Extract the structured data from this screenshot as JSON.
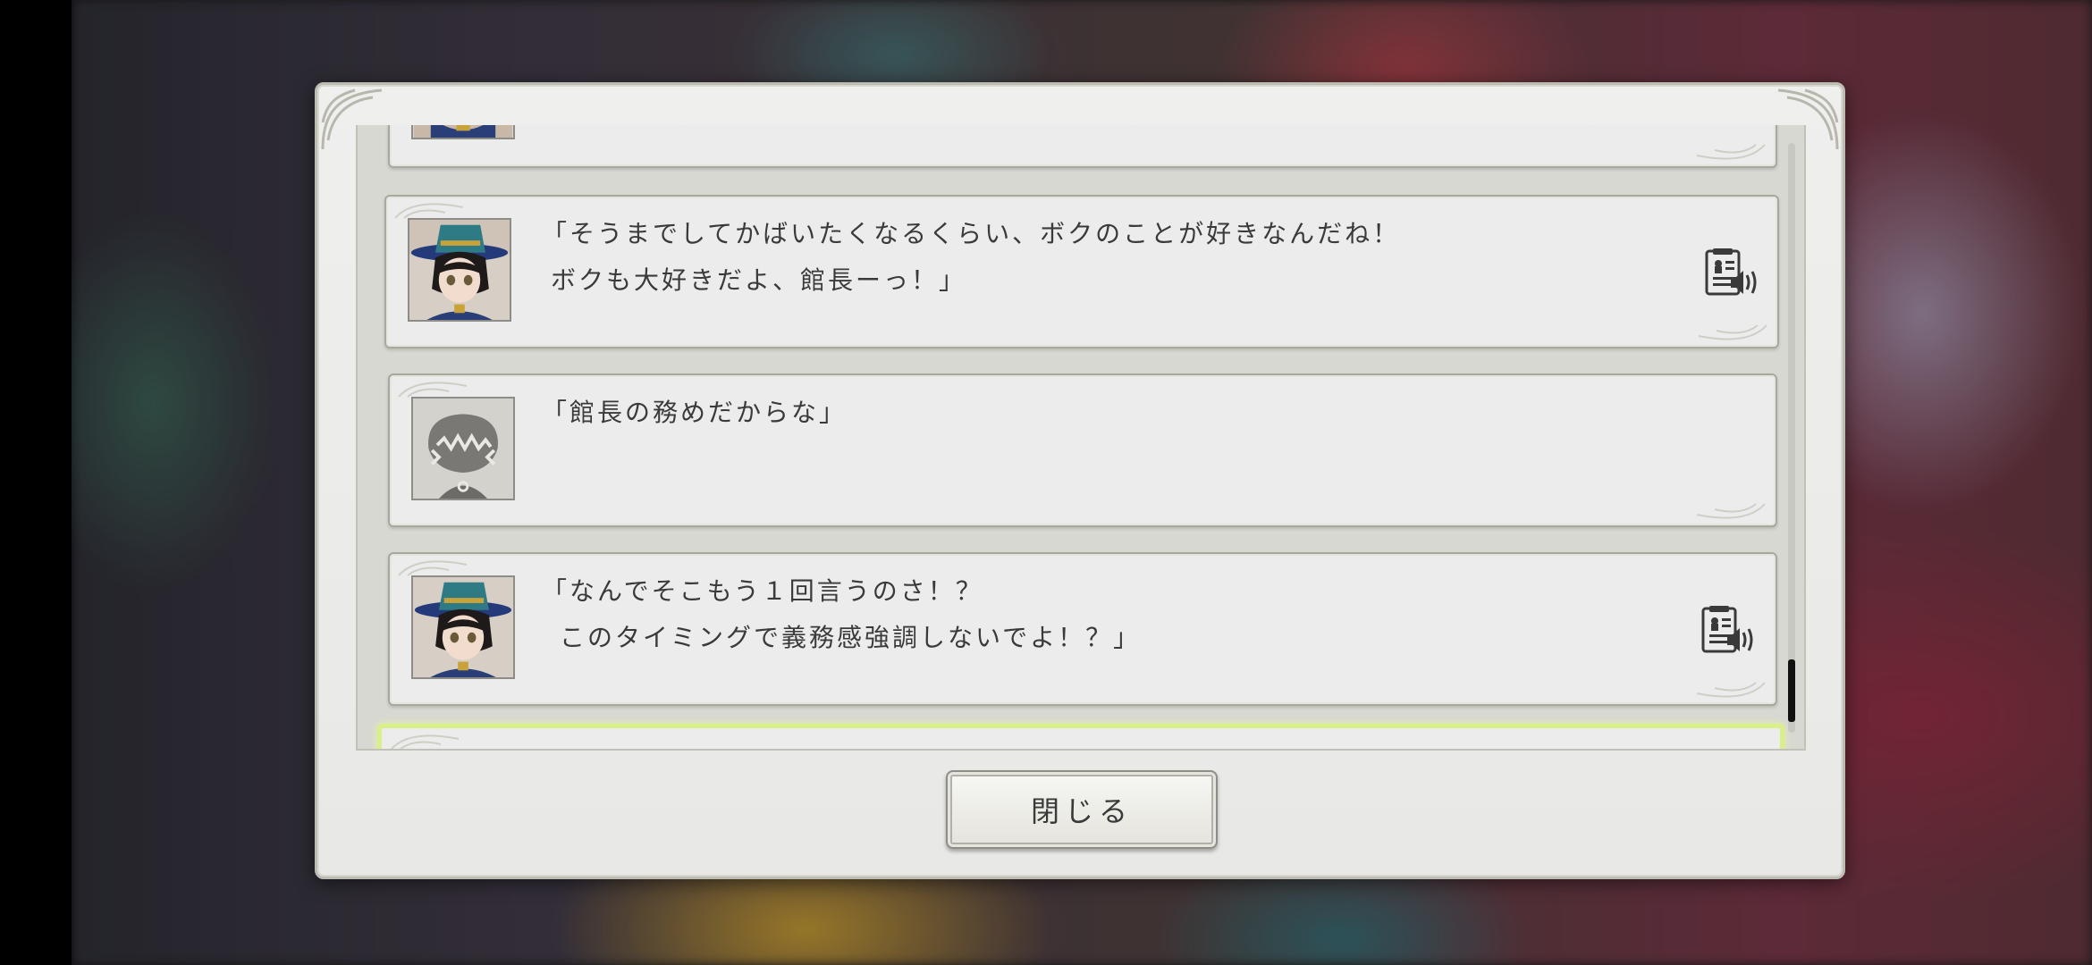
{
  "dialog": {
    "close_label": "閉じる"
  },
  "log": {
    "entries": [
      {
        "speaker": "character",
        "line1": "「そうまでしてかばいたくなるくらい、ボクのことが好きなんだね！",
        "line2": "ボクも大好きだよ、館長ーっ！」",
        "voice": true
      },
      {
        "speaker": "player",
        "line1": "「館長の務めだからな」",
        "line2": "",
        "voice": false
      },
      {
        "speaker": "character",
        "line1": "「なんでそこもう１回言うのさ！？",
        "line2": "このタイミングで義務感強調しないでよ！？」",
        "voice": true
      }
    ]
  },
  "icons": {
    "voice": "voice-replay-icon",
    "avatar_character": "character-portrait",
    "avatar_player": "player-silhouette-icon"
  },
  "colors": {
    "highlight_entry_border": "#d9ef8a",
    "scroll_thumb": "#111111"
  }
}
